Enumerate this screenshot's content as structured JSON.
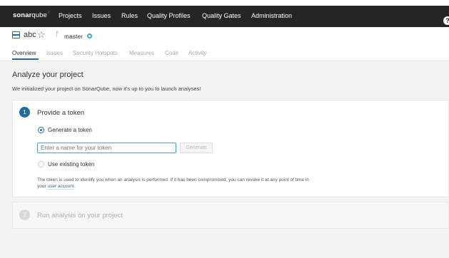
{
  "topbar": {
    "logo_main": "sonar",
    "logo_suffix": "qube",
    "nav": [
      "Projects",
      "Issues",
      "Rules",
      "Quality Profiles",
      "Quality Gates",
      "Administration"
    ],
    "help_icon": "help-icon"
  },
  "project": {
    "name": "abc",
    "branch": "master"
  },
  "tabs": [
    "Overview",
    "Issues",
    "Security Hotspots",
    "Measures",
    "Code",
    "Activity"
  ],
  "main": {
    "title": "Analyze your project",
    "description": "We initialized your project on SonarQube, now it's up to you to launch analyses!"
  },
  "step1": {
    "number": "1",
    "title": "Provide a token",
    "option_generate": "Generate a token",
    "token_placeholder": "Enter a name for your token",
    "token_value": "",
    "generate_button": "Generate",
    "option_existing": "Use existing token",
    "help_text": "The token is used to identify you when an analysis is performed. If it has been compromised, you can revoke it at any point of time in your ",
    "help_link": "user account",
    "help_end": "."
  },
  "step2": {
    "number": "2",
    "title": "Run analysis on your project"
  },
  "colors": {
    "topbar": "#252525",
    "accent": "#236a97",
    "accent_light": "#4b9fd5",
    "background": "#f3f3f3"
  }
}
